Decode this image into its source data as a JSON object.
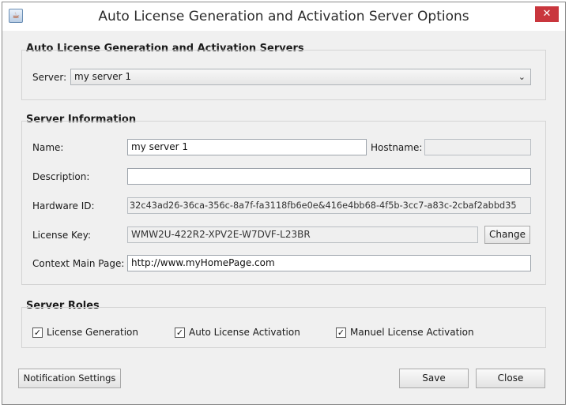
{
  "window": {
    "title": "Auto License Generation and Activation Server Options",
    "close_glyph": "✕"
  },
  "servers_group": {
    "title": "Auto License Generation and Activation Servers",
    "server_label": "Server:",
    "server_value": "my server 1"
  },
  "server_info": {
    "title": "Server Information",
    "name_label": "Name:",
    "name_value": "my server 1",
    "hostname_label": "Hostname:",
    "hostname_value": "",
    "description_label": "Description:",
    "description_value": "",
    "hardware_id_label": "Hardware ID:",
    "hardware_id_value": "32c43ad26-36ca-356c-8a7f-fa3118fb6e0e&416e4bb68-4f5b-3cc7-a83c-2cbaf2abbd35",
    "license_key_label": "License Key:",
    "license_key_value": "WMW2U-422R2-XPV2E-W7DVF-L23BR",
    "change_label": "Change",
    "context_label": "Context Main Page:",
    "context_value": "http://www.myHomePage.com"
  },
  "roles": {
    "title": "Server Roles",
    "items": [
      {
        "label": "License Generation",
        "checked": true
      },
      {
        "label": "Auto License Activation",
        "checked": true
      },
      {
        "label": "Manuel License Activation",
        "checked": true
      }
    ],
    "check_glyph": "✓"
  },
  "footer": {
    "notification_label": "Notification Settings",
    "save_label": "Save",
    "close_label": "Close"
  }
}
